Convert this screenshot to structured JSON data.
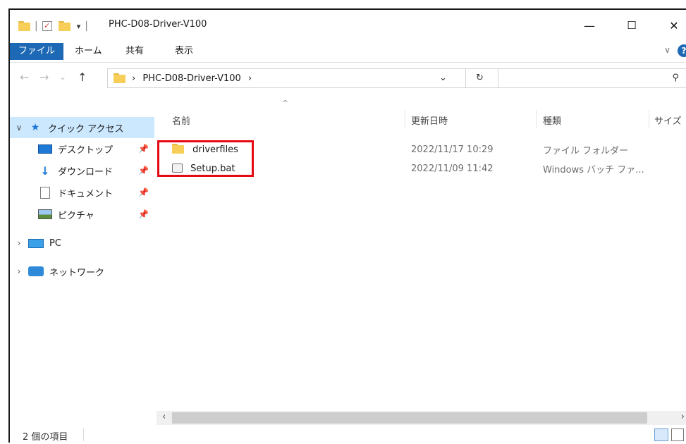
{
  "window": {
    "title": "PHC-D08-Driver-V100",
    "controls": {
      "minimize": "—",
      "maximize": "☐",
      "close": "✕"
    }
  },
  "ribbon": {
    "tabs": [
      "ファイル",
      "ホーム",
      "共有",
      "表示"
    ],
    "help": "?"
  },
  "navigation": {
    "back": "←",
    "forward": "→",
    "recent": "⌄",
    "up": "↑",
    "address": "PHC-D08-Driver-V100",
    "address_sep1": "›",
    "address_sep2": "›",
    "dropdown": "⌄",
    "refresh": "↻",
    "search_placeholder": "",
    "search_icon": "⚲"
  },
  "sidebar": {
    "quick_access": "クイック アクセス",
    "items": [
      {
        "label": "デスクトップ",
        "icon": "desktop-icon",
        "pinned": true
      },
      {
        "label": "ダウンロード",
        "icon": "download-icon",
        "pinned": true
      },
      {
        "label": "ドキュメント",
        "icon": "document-icon",
        "pinned": true
      },
      {
        "label": "ピクチャ",
        "icon": "pictures-icon",
        "pinned": true
      }
    ],
    "pc": "PC",
    "network": "ネットワーク"
  },
  "file_list": {
    "columns": [
      "名前",
      "更新日時",
      "種類",
      "サイズ"
    ],
    "rows": [
      {
        "name": "driverfiles",
        "modified": "2022/11/17 10:29",
        "type": "ファイル フォルダー",
        "icon": "folder-icon"
      },
      {
        "name": "Setup.bat",
        "modified": "2022/11/09 11:42",
        "type": "Windows バッチ ファ...",
        "icon": "batch-file-icon"
      }
    ]
  },
  "status_bar": {
    "item_count": "2 個の項目"
  },
  "colors": {
    "accent": "#1d69b6",
    "selection": "#cce8ff",
    "highlight_box": "#e50914",
    "folder": "#f7cf58"
  }
}
